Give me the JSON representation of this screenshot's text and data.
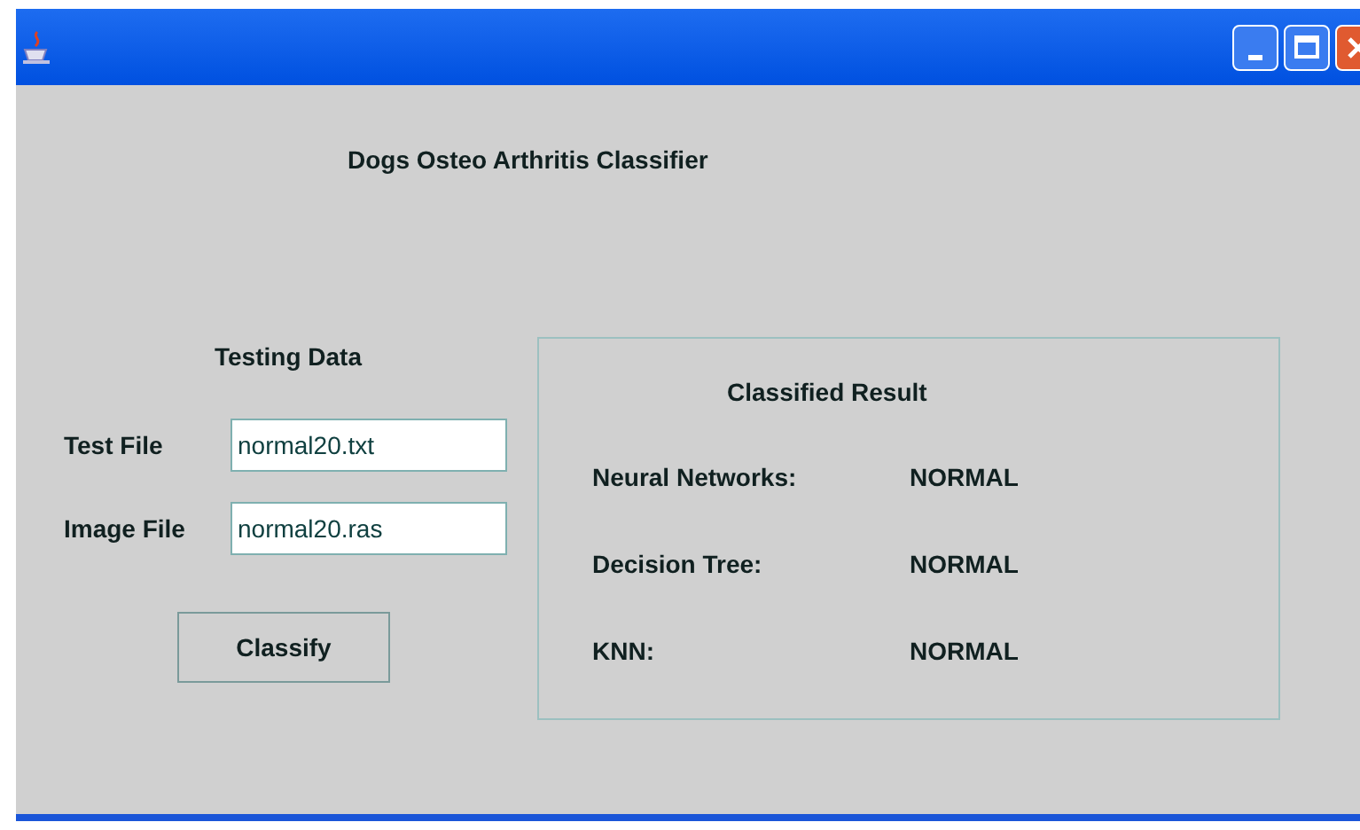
{
  "window": {
    "title": "Dogs Osteo Arthritis Classifier"
  },
  "testing_data": {
    "heading": "Testing Data",
    "fields": [
      {
        "label": "Test File",
        "value": "normal20.txt"
      },
      {
        "label": "Image File",
        "value": "normal20.ras"
      }
    ],
    "button": "Classify"
  },
  "classified_result": {
    "heading": "Classified Result",
    "rows": [
      {
        "label": "Neural Networks:",
        "value": "NORMAL"
      },
      {
        "label": "Decision Tree:",
        "value": "NORMAL"
      },
      {
        "label": "KNN:",
        "value": "NORMAL"
      }
    ]
  }
}
